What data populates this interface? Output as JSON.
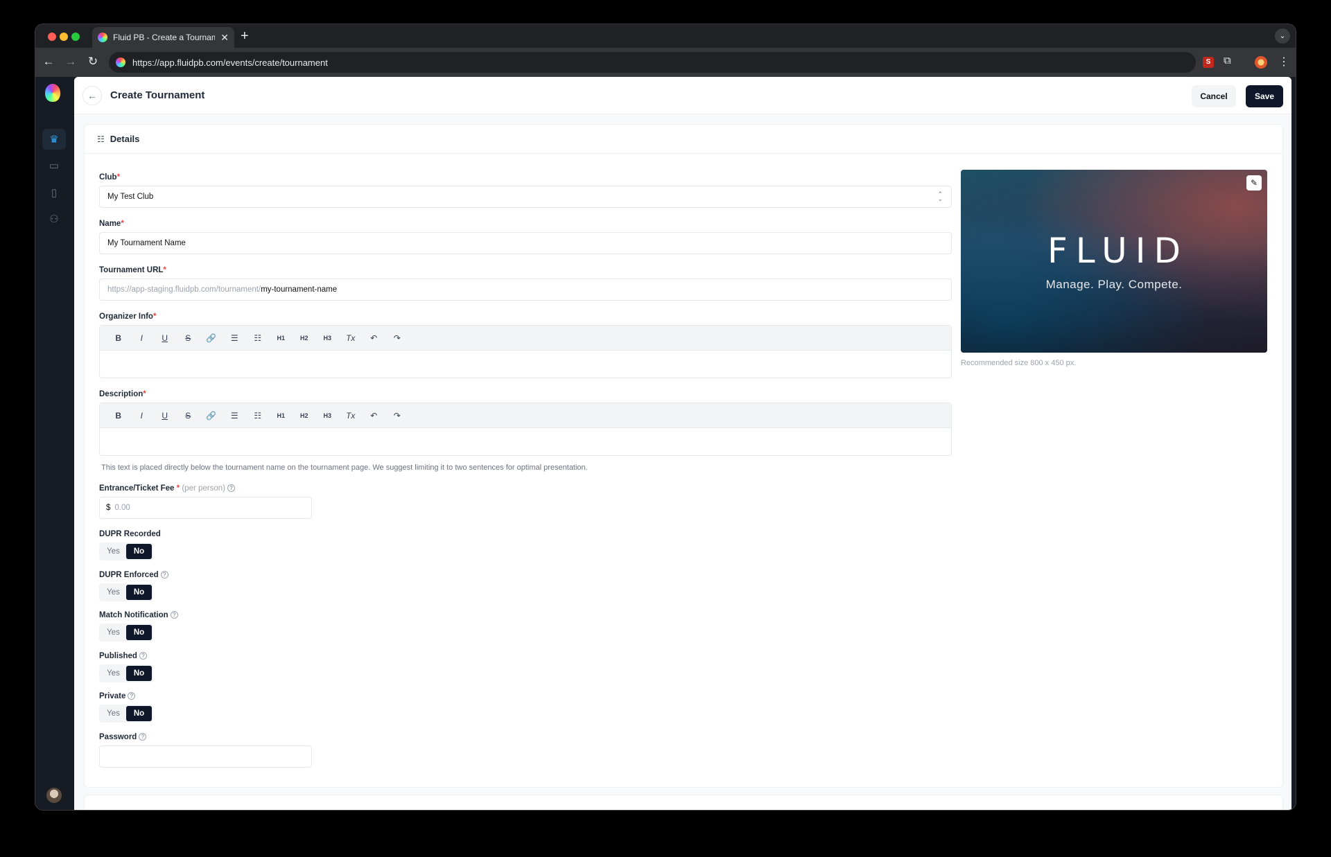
{
  "browser": {
    "tab_title": "Fluid PB - Create a Tourname",
    "tab_close": "✕",
    "new_tab": "+",
    "tab_menu": "⌄",
    "back": "←",
    "forward": "→",
    "reload": "↻",
    "url": "https://app.fluidpb.com/events/create/tournament",
    "ext_label": "S",
    "puzzle": "⧉",
    "kebab": "⋮"
  },
  "header": {
    "back_arrow": "←",
    "title": "Create Tournament",
    "cancel_label": "Cancel",
    "save_label": "Save"
  },
  "sidebar": {
    "icons": [
      "trophy-icon",
      "calendar-icon",
      "book-icon",
      "users-icon"
    ],
    "glyphs": [
      "♛",
      "▭",
      "▯",
      "⚇"
    ]
  },
  "section": {
    "icon": "☷",
    "title": "Details"
  },
  "form": {
    "club": {
      "label": "Club",
      "required": "*",
      "value": "My Test Club"
    },
    "name": {
      "label": "Name",
      "required": "*",
      "value": "My Tournament Name"
    },
    "url": {
      "label": "Tournament URL",
      "required": "*",
      "prefix": "https://app-staging.fluidpb.com/tournament/",
      "slug": "my-tournament-name"
    },
    "organizer": {
      "label": "Organizer Info",
      "required": "*"
    },
    "description": {
      "label": "Description",
      "required": "*",
      "hint": "This text is placed directly below the tournament name on the tournament page. We suggest limiting it to two sentences for optimal presentation."
    },
    "fee": {
      "label": "Entrance/Ticket Fee",
      "required": "*",
      "suffix": "(per person)",
      "help": "?",
      "currency": "$",
      "placeholder": "0.00"
    },
    "toggles": [
      {
        "label": "DUPR Recorded",
        "help": "",
        "yes": "Yes",
        "no": "No"
      },
      {
        "label": "DUPR Enforced",
        "help": "?",
        "yes": "Yes",
        "no": "No"
      },
      {
        "label": "Match Notification",
        "help": "?",
        "yes": "Yes",
        "no": "No"
      },
      {
        "label": "Published",
        "help": "?",
        "yes": "Yes",
        "no": "No"
      },
      {
        "label": "Private",
        "help": "?",
        "yes": "Yes",
        "no": "No"
      }
    ],
    "password": {
      "label": "Password",
      "help": "?"
    }
  },
  "editor_toolbar": {
    "buttons": [
      "B",
      "I",
      "U",
      "S",
      "🔗",
      "☰",
      "☷",
      "H1",
      "H2",
      "H3",
      "Tx",
      "↶",
      "↷"
    ]
  },
  "banner": {
    "logo_text": "FLUID",
    "tagline": "Manage. Play. Compete.",
    "edit_icon": "✎",
    "note": "Recommended size 800 x 450 px."
  }
}
